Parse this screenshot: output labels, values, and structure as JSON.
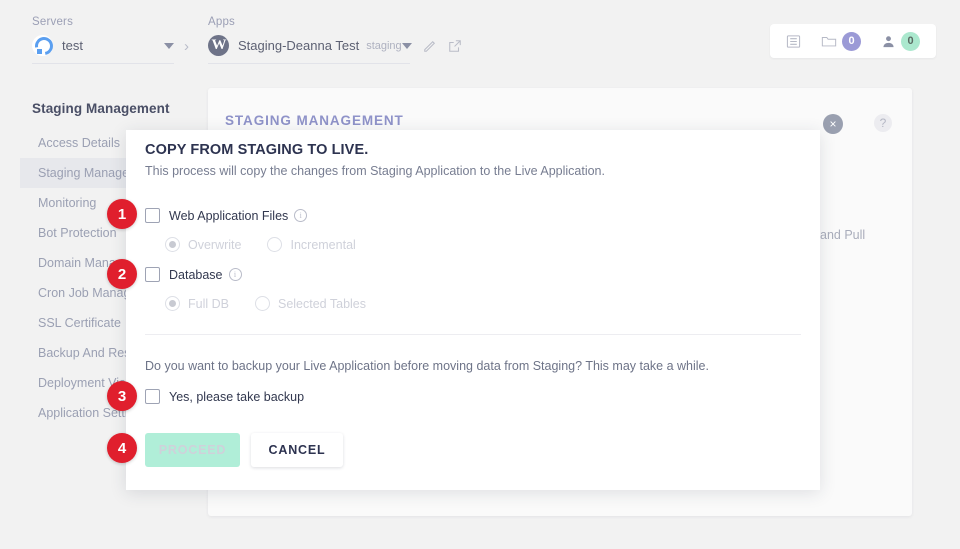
{
  "topbar": {
    "server": {
      "label": "Servers",
      "name": "test",
      "icon": "digitalocean-icon",
      "caret": "chevron-down-icon"
    },
    "separator": "›",
    "app": {
      "label": "Apps",
      "name": "Staging-Deanna Test",
      "tag": "staging",
      "icon": "wordpress-icon",
      "caret": "chevron-down-icon",
      "edit_icon": "pencil-icon",
      "open_icon": "external-link-icon"
    },
    "actions": [
      {
        "name": "server-list-icon",
        "icon": "list-icon",
        "count": null
      },
      {
        "name": "folder-count",
        "icon": "folder-icon",
        "count": "0"
      },
      {
        "name": "user-count",
        "icon": "user-icon",
        "count": "0"
      }
    ]
  },
  "sidebar": {
    "title": "Staging Management",
    "items": [
      {
        "label": "Access Details",
        "active": false
      },
      {
        "label": "Staging Management",
        "active": true
      },
      {
        "label": "Monitoring",
        "active": false
      },
      {
        "label": "Bot Protection",
        "active": false
      },
      {
        "label": "Domain Management",
        "active": false
      },
      {
        "label": "Cron Job Management",
        "active": false
      },
      {
        "label": "SSL Certificate",
        "active": false
      },
      {
        "label": "Backup And Restore",
        "active": false
      },
      {
        "label": "Deployment Via Git",
        "active": false
      },
      {
        "label": "Application Settings",
        "active": false
      }
    ]
  },
  "card": {
    "title": "STAGING MANAGEMENT",
    "close_icon": "×",
    "help_icon": "?",
    "ghost_text": "and Pull"
  },
  "modal": {
    "title": "COPY FROM STAGING TO LIVE.",
    "subtitle": "This process will copy the changes from Staging Application to the Live Application.",
    "options": [
      {
        "label": "Web Application Files",
        "checked": false,
        "info_icon": "i",
        "radios": [
          {
            "label": "Overwrite",
            "selected": true
          },
          {
            "label": "Incremental",
            "selected": false
          }
        ]
      },
      {
        "label": "Database",
        "checked": false,
        "info_icon": "i",
        "radios": [
          {
            "label": "Full DB",
            "selected": true
          },
          {
            "label": "Selected Tables",
            "selected": false
          }
        ]
      }
    ],
    "question": "Do you want to backup your Live Application before moving data from Staging? This may take a while.",
    "backup": {
      "label": "Yes, please take backup",
      "checked": false
    },
    "buttons": {
      "proceed": "PROCEED",
      "cancel": "CANCEL"
    }
  },
  "badges": [
    {
      "number": "1"
    },
    {
      "number": "2"
    },
    {
      "number": "3"
    },
    {
      "number": "4"
    }
  ],
  "colors": {
    "badge_red": "#e01f2d",
    "proceed_green": "#b0eed8",
    "accent_purple": "#8f93c9",
    "bubble_purple": "#9b9ad6",
    "bubble_green": "#abe8ce"
  }
}
